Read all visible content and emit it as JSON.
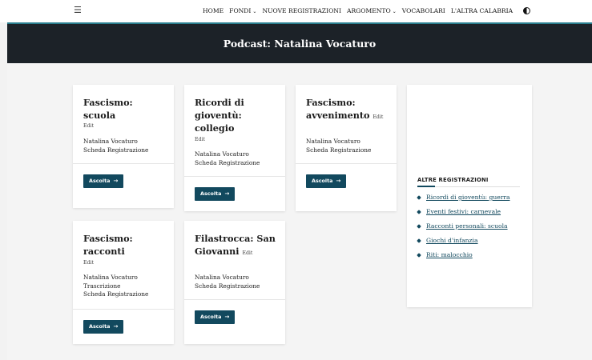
{
  "nav": {
    "menu_icon": "hamburger-icon",
    "items": [
      {
        "label": "HOME",
        "dropdown": false
      },
      {
        "label": "FONDI",
        "dropdown": true
      },
      {
        "label": "NUOVE REGISTRAZIONI",
        "dropdown": false
      },
      {
        "label": "ARGOMENTO",
        "dropdown": true
      },
      {
        "label": "VOCABOLARI",
        "dropdown": false
      },
      {
        "label": "L'ALTRA CALABRIA",
        "dropdown": false
      }
    ],
    "theme_icon": "contrast-toggle-icon"
  },
  "header": {
    "title": "Podcast: Natalina Vocaturo"
  },
  "cards": [
    {
      "title": "Fascismo: scuola",
      "edit": "Edit",
      "meta": [
        "Natalina Vocaturo",
        "Scheda Registrazione"
      ],
      "button": "Ascolta"
    },
    {
      "title": "Ricordi di gioventù: collegio",
      "edit": "Edit",
      "meta": [
        "Natalina Vocaturo",
        "Scheda Registrazione"
      ],
      "button": "Ascolta"
    },
    {
      "title": "Fascismo: avvenimento",
      "edit": "Edit",
      "meta": [
        "Natalina Vocaturo",
        "Scheda Registrazione"
      ],
      "button": "Ascolta"
    },
    {
      "title": "Fascismo: racconti",
      "edit": "Edit",
      "meta": [
        "Natalina Vocaturo",
        "Trascrizione",
        "Scheda Registrazione"
      ],
      "button": "Ascolta"
    },
    {
      "title": "Filastrocca: San Giovanni",
      "edit": "Edit",
      "meta": [
        "Natalina Vocaturo",
        "Scheda Registrazione"
      ],
      "button": "Ascolta"
    }
  ],
  "sidebar": {
    "heading": "ALTRE REGISTRAZIONI",
    "links": [
      "Ricordi di gioventù: guerra",
      "Eventi festivi: carnevale",
      "Racconti personali: scuola",
      "Giochi d'infanzia",
      "Riti: malocchio"
    ]
  },
  "colors": {
    "header_bg": "#1c2228",
    "accent": "#12495e",
    "header_border": "#2a7f8f",
    "page_bg": "#f4f4f4"
  }
}
